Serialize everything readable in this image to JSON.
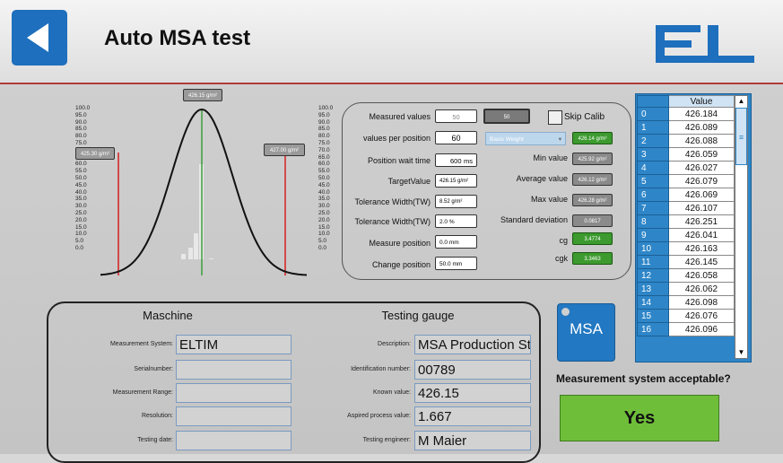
{
  "header": {
    "title": "Auto MSA test"
  },
  "gauss_chart": {
    "ticks": [
      "100.0",
      "95.0",
      "90.0",
      "85.0",
      "80.0",
      "75.0",
      "70.0",
      "65.0",
      "60.0",
      "55.0",
      "50.0",
      "45.0",
      "40.0",
      "35.0",
      "30.0",
      "25.0",
      "20.0",
      "15.0",
      "10.0",
      "5.0",
      "0.0"
    ],
    "lower_label": "425.30 g/m²",
    "target_label": "426.15 g/m²",
    "upper_label": "427.00 g/m²"
  },
  "params": {
    "measured_values_label": "Measured values",
    "measured_values": "50",
    "measured_count": "50",
    "skip_calib_label": "Skip Calib",
    "values_per_position_label": "values per position",
    "values_per_position": "60",
    "basis_weight": "Basis Weight",
    "basis_weight_value": "426.14 g/m²",
    "position_wait_label": "Position wait time",
    "position_wait": "600",
    "position_wait_unit": "ms",
    "min_label": "Min value",
    "min_value": "425.92 g/m²",
    "target_label": "TargetValue",
    "target_value": "426.15 g/m²",
    "avg_label": "Average value",
    "avg_value": "426.12 g/m²",
    "tol_width_label": "Tolerance Width(TW)",
    "tol_width": "8.52 g/m²",
    "max_label": "Max value",
    "max_value": "426.28 g/m²",
    "tol_width_pct_label": "Tolerance Width(TW)",
    "tol_width_pct": "2.0 %",
    "stddev_label": "Standard deviation",
    "stddev": "0.0817",
    "measure_pos_label": "Measure position",
    "measure_pos": "0.0 mm",
    "cg_label": "cg",
    "cg": "3.4774",
    "change_pos_label": "Change position",
    "change_pos": "50.0 mm",
    "cgk_label": "cgk",
    "cgk": "3.3463"
  },
  "table": {
    "header": "Value",
    "rows": [
      {
        "i": "0",
        "v": "426.184"
      },
      {
        "i": "1",
        "v": "426.089"
      },
      {
        "i": "2",
        "v": "426.088"
      },
      {
        "i": "3",
        "v": "426.059"
      },
      {
        "i": "4",
        "v": "426.027"
      },
      {
        "i": "5",
        "v": "426.079"
      },
      {
        "i": "6",
        "v": "426.069"
      },
      {
        "i": "7",
        "v": "426.107"
      },
      {
        "i": "8",
        "v": "426.251"
      },
      {
        "i": "9",
        "v": "426.041"
      },
      {
        "i": "10",
        "v": "426.163"
      },
      {
        "i": "11",
        "v": "426.145"
      },
      {
        "i": "12",
        "v": "426.058"
      },
      {
        "i": "13",
        "v": "426.062"
      },
      {
        "i": "14",
        "v": "426.098"
      },
      {
        "i": "15",
        "v": "426.076"
      },
      {
        "i": "16",
        "v": "426.096"
      }
    ]
  },
  "machine": {
    "title": "Maschine",
    "fields": [
      {
        "label": "Measurement System:",
        "value": "ELTIM"
      },
      {
        "label": "Serialnumber:",
        "value": ""
      },
      {
        "label": "Measurement Range:",
        "value": ""
      },
      {
        "label": "Resolution:",
        "value": ""
      },
      {
        "label": "Testing date:",
        "value": ""
      }
    ]
  },
  "gauge": {
    "title": "Testing gauge",
    "fields": [
      {
        "label": "Description:",
        "value": "MSA Production Start"
      },
      {
        "label": "Identification number:",
        "value": "00789"
      },
      {
        "label": "Known value:",
        "value": "426.15"
      },
      {
        "label": "Aspired process value:",
        "value": "1.667"
      },
      {
        "label": "Testing engineer:",
        "value": "M Maier"
      }
    ]
  },
  "msa_button": "MSA",
  "result": {
    "question": "Measurement system acceptable?",
    "answer": "Yes"
  },
  "colors": {
    "accent": "#1e6fbd",
    "ok_green": "#6fbe3a",
    "limit_red": "#d42020"
  }
}
